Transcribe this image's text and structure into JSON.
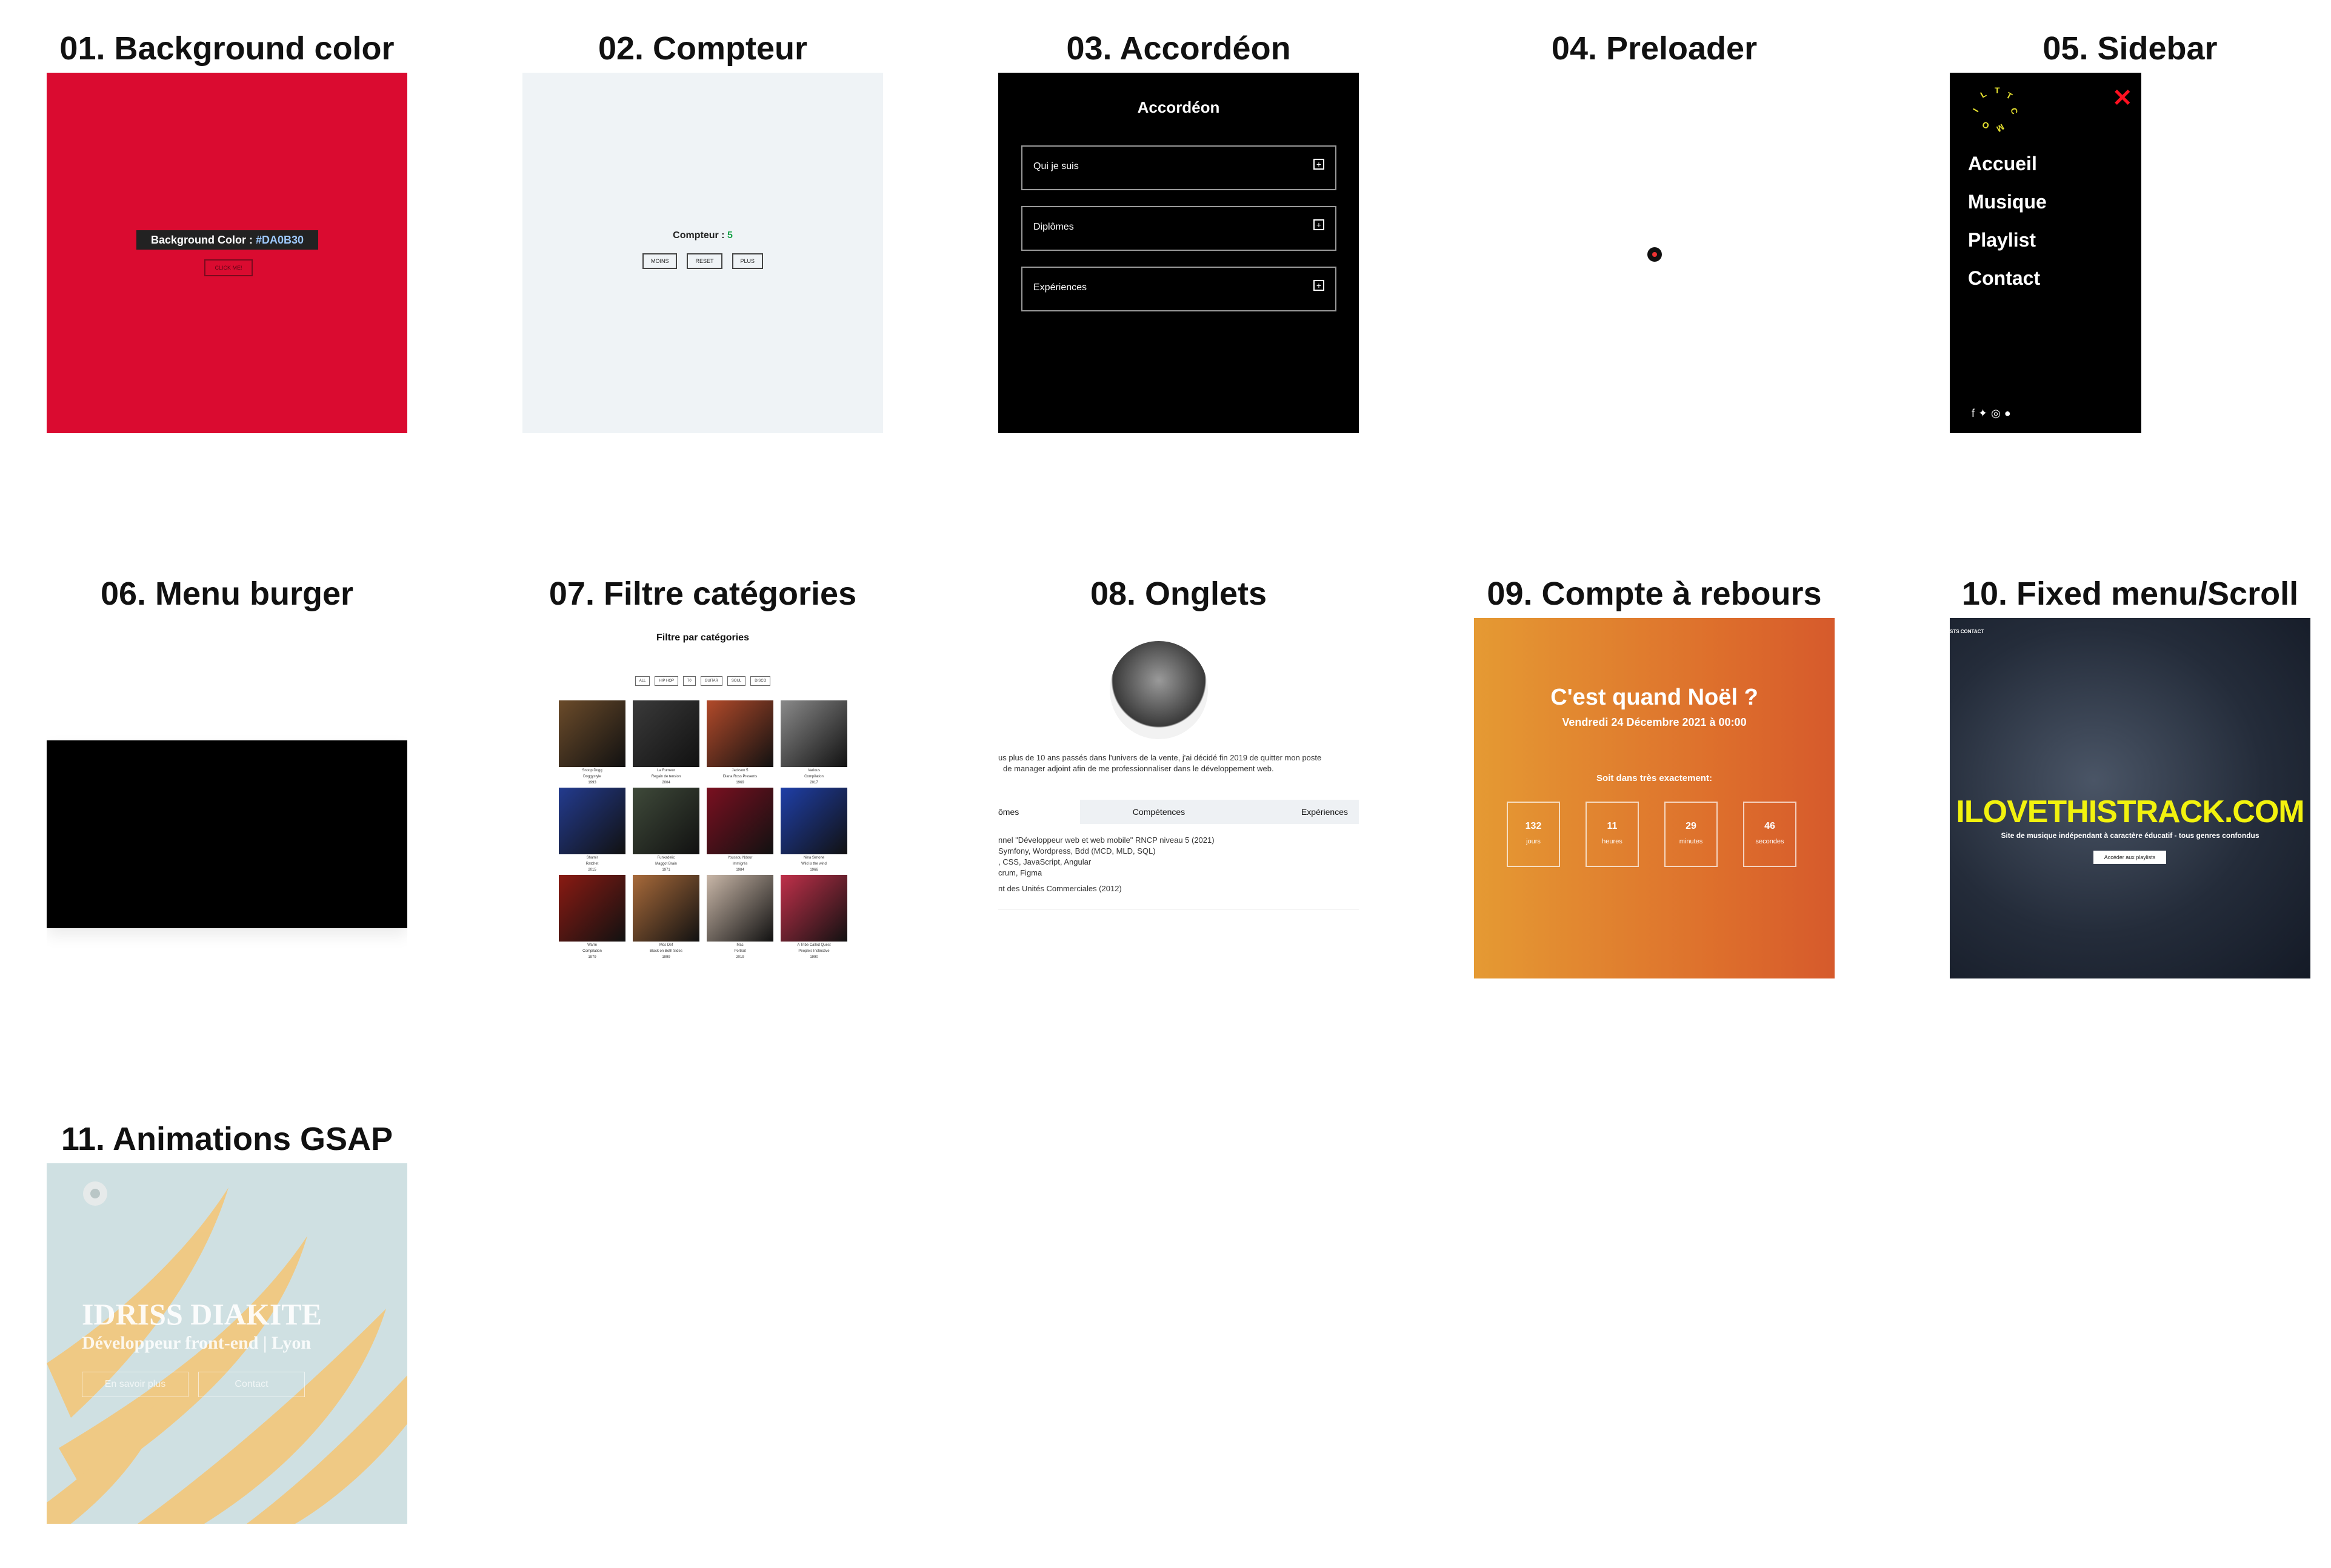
{
  "projects": [
    {
      "title": "01. Background color"
    },
    {
      "title": "02. Compteur"
    },
    {
      "title": "03. Accordéon"
    },
    {
      "title": "04. Preloader"
    },
    {
      "title": "05. Sidebar"
    },
    {
      "title": "06. Menu burger"
    },
    {
      "title": "07. Filtre catégories"
    },
    {
      "title": "08. Onglets"
    },
    {
      "title": "09. Compte à rebours"
    },
    {
      "title": "10. Fixed menu/Scroll"
    },
    {
      "title": "11. Animations GSAP"
    }
  ],
  "bg_color": {
    "label": "Background Color :",
    "value": "#DA0B30",
    "button": "CLICK ME!"
  },
  "counter": {
    "label": "Compteur :",
    "value": "5",
    "buttons": [
      "MOINS",
      "RESET",
      "PLUS"
    ]
  },
  "accordion": {
    "title": "Accordéon",
    "items": [
      "Qui je suis",
      "Diplômes",
      "Expériences"
    ]
  },
  "sidebar": {
    "items": [
      "Accueil",
      "Musique",
      "Playlist",
      "Contact"
    ],
    "logo_text": "ILTTCMO"
  },
  "filter": {
    "title": "Filtre par catégories",
    "buttons": [
      "ALL",
      "HIP HOP",
      "70",
      "GUITAR",
      "SOUL",
      "DISCO"
    ],
    "covers": [
      {
        "title": "Snoop Dogg",
        "sub": "Doggystyle",
        "year": "1993",
        "color": "#6b4b2a"
      },
      {
        "title": "La Rumeur",
        "sub": "Regain de tension",
        "year": "2004",
        "color": "#3a3a3a"
      },
      {
        "title": "Jackson 5",
        "sub": "Diana Ross Presents",
        "year": "1969",
        "color": "#b24a2a"
      },
      {
        "title": "Various",
        "sub": "Compilation",
        "year": "2017",
        "color": "#8a8a8a"
      },
      {
        "title": "Shamir",
        "sub": "Ratchet",
        "year": "2015",
        "color": "#233b8f"
      },
      {
        "title": "Funkadelic",
        "sub": "Maggot Brain",
        "year": "1971",
        "color": "#3f4a3a"
      },
      {
        "title": "Youssou Ndour",
        "sub": "Immigrés",
        "year": "1984",
        "color": "#7a1020"
      },
      {
        "title": "Nina Simone",
        "sub": "Wild is the wind",
        "year": "1966",
        "color": "#1f3fa8"
      },
      {
        "title": "Warm",
        "sub": "Compilation",
        "year": "1979",
        "color": "#8a1a12"
      },
      {
        "title": "Mos Def",
        "sub": "Black on Both Sides",
        "year": "1999",
        "color": "#a86a3a"
      },
      {
        "title": "Mac",
        "sub": "Portrait",
        "year": "2019",
        "color": "#c9b7a8"
      },
      {
        "title": "A Tribe Called Quest",
        "sub": "People's Instinctive",
        "year": "1990",
        "color": "#c0304a"
      }
    ]
  },
  "tabs": {
    "bio": [
      "us plus de 10 ans passés dans l'univers de la vente, j'ai décidé fin 2019 de quitter mon poste",
      "de manager adjoint afin de me professionnaliser dans le développement web."
    ],
    "labels": [
      "ômes",
      "Compétences",
      "Expériences"
    ],
    "content": [
      "nnel \"Développeur web et web mobile\" RNCP niveau 5 (2021)",
      "Symfony, Wordpress, Bdd (MCD, MLD, SQL)",
      ", CSS, JavaScript, Angular",
      "crum, Figma",
      "nt des Unités Commerciales (2012)"
    ]
  },
  "countdown": {
    "title": "C'est quand Noël ?",
    "date": "Vendredi 24 Décembre 2021 à 00:00",
    "subtitle": "Soit dans très exactement:",
    "units": [
      {
        "n": "132",
        "u": "jours"
      },
      {
        "n": "11",
        "u": "heures"
      },
      {
        "n": "29",
        "u": "minutes"
      },
      {
        "n": "46",
        "u": "secondes"
      }
    ]
  },
  "scroll": {
    "menu": "STS    CONTACT",
    "title": "ILOVETHISTRACK.COM",
    "subtitle": "Site de musique indépendant à caractère éducatif - tous genres confondus",
    "cta": "Accéder aux playlists"
  },
  "gsap": {
    "name": "IDRISS DIAKITE",
    "role": "Développeur front-end | Lyon",
    "buttons": [
      "En savoir plus",
      "Contact"
    ]
  }
}
